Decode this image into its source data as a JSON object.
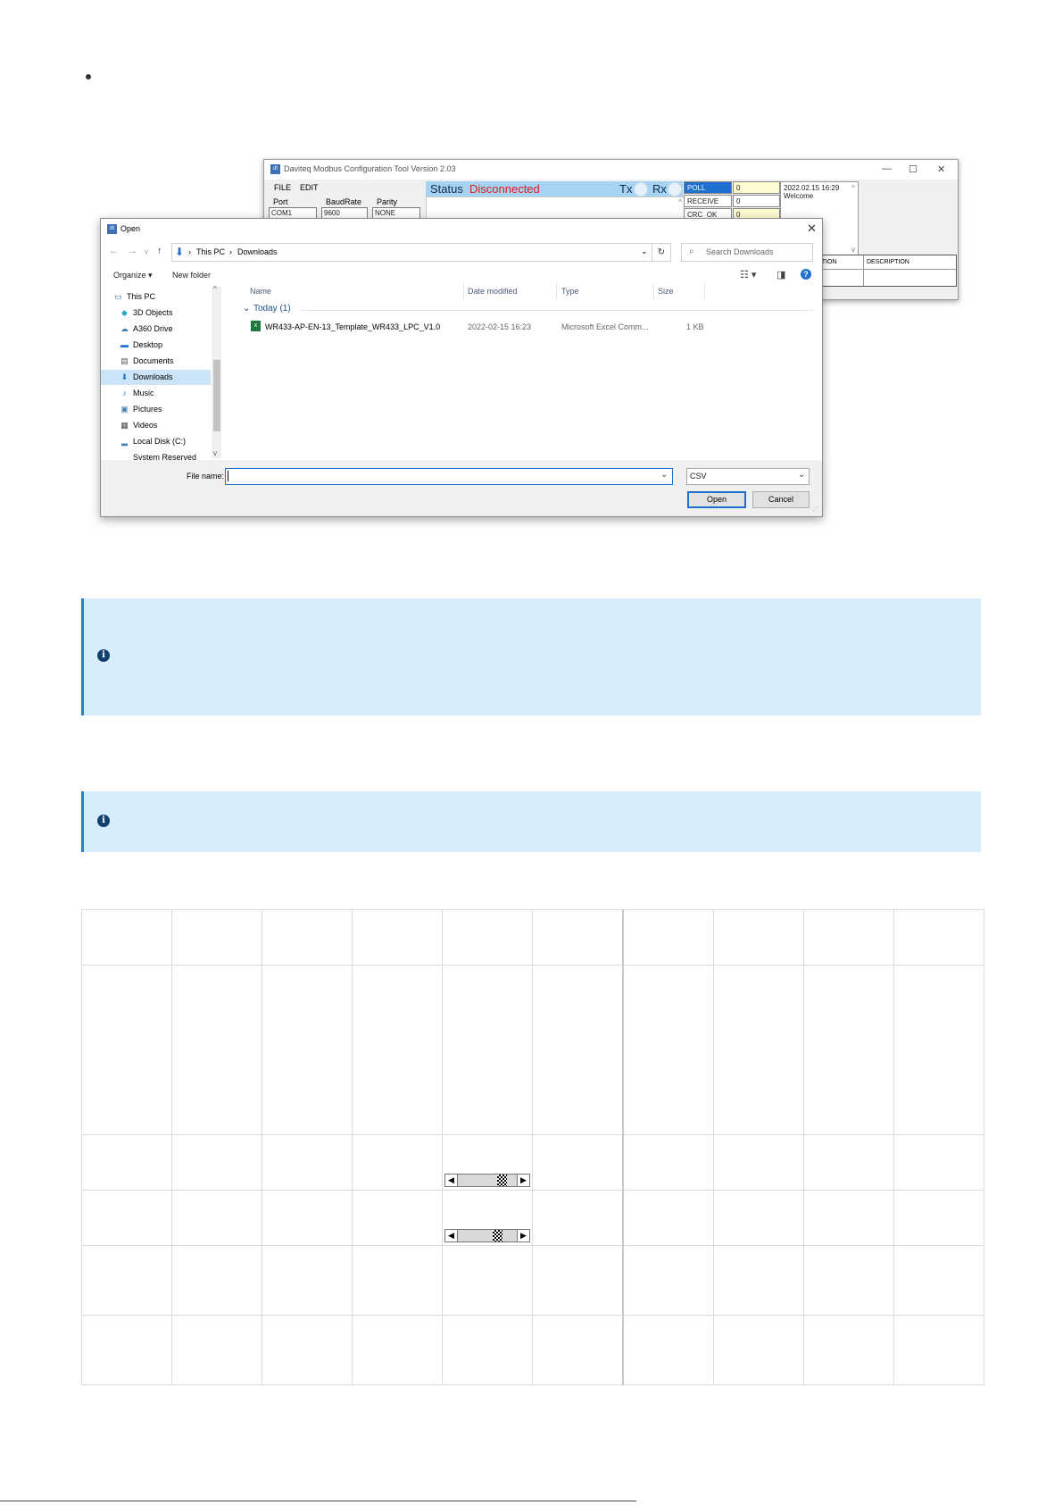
{
  "modbus": {
    "title": "Daviteq Modbus Configuration Tool Version 2.03",
    "icon": "app-icon",
    "menu": [
      "FILE",
      "EDIT"
    ],
    "port_label": "Port",
    "port_value": "COM1",
    "baud_label": "BaudRate",
    "baud_value": "9600",
    "parity_label": "Parity",
    "parity_value": "NONE",
    "status_label": "Status",
    "status_value": "Disconnected",
    "tx_label": "Tx",
    "rx_label": "Rx",
    "counters": [
      {
        "label": "POLL",
        "value": "0"
      },
      {
        "label": "RECEIVE",
        "value": "0"
      },
      {
        "label": "CRC_OK",
        "value": "0"
      }
    ],
    "log_time": "2022.02.15 16:29",
    "log_text": "Welcome",
    "exception_header": "EXCEPTION",
    "description_header": "DESCRIPTION",
    "status_color": "#e01a1a"
  },
  "dialog": {
    "title": "Open",
    "breadcrumb": [
      "This PC",
      "Downloads"
    ],
    "search_placeholder": "Search Downloads",
    "organize": "Organize ▾",
    "new_folder": "New folder",
    "nav_items": [
      {
        "label": "This PC",
        "icon": "computer-icon"
      },
      {
        "label": "3D Objects",
        "icon": "cube-icon"
      },
      {
        "label": "A360 Drive",
        "icon": "cloud-icon"
      },
      {
        "label": "Desktop",
        "icon": "desktop-icon"
      },
      {
        "label": "Documents",
        "icon": "document-icon"
      },
      {
        "label": "Downloads",
        "icon": "download-icon",
        "selected": true
      },
      {
        "label": "Music",
        "icon": "music-icon"
      },
      {
        "label": "Pictures",
        "icon": "picture-icon"
      },
      {
        "label": "Videos",
        "icon": "video-icon"
      },
      {
        "label": "Local Disk (C:)",
        "icon": "disk-icon"
      },
      {
        "label": "System Reserved (D:)",
        "icon": "drive-icon"
      }
    ],
    "columns": [
      "Name",
      "Date modified",
      "Type",
      "Size"
    ],
    "group": "Today (1)",
    "file": {
      "name": "WR433-AP-EN-13_Template_WR433_LPC_V1.0",
      "date": "2022-02-15 16:23",
      "type": "Microsoft Excel Comm...",
      "size": "1 KB"
    },
    "file_name_label": "File name:",
    "file_name_value": "",
    "filter_value": "CSV",
    "open_button": "Open",
    "cancel_button": "Cancel",
    "accent": "#1f6fd0"
  },
  "callouts": [
    {
      "icon": "info-icon"
    },
    {
      "icon": "info-icon"
    }
  ],
  "table": {
    "columns": 10,
    "rows": 6,
    "scrollbars": [
      {
        "row": 3,
        "col": 5,
        "thumb_position": 0.8
      },
      {
        "row": 4,
        "col": 5,
        "thumb_position": 0.7
      }
    ]
  }
}
